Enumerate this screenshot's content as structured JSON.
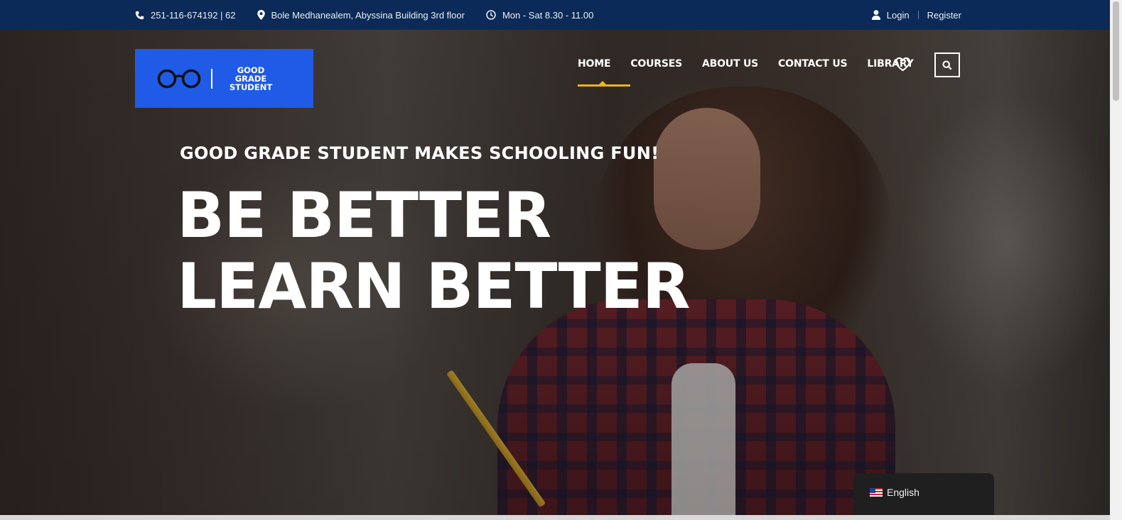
{
  "topbar": {
    "phone": "251-116-674192 | 62",
    "address": "Bole Medhanealem, Abyssina Building 3rd floor",
    "hours": "Mon - Sat 8.30 - 11.00",
    "login": "Login",
    "register": "Register"
  },
  "logo": {
    "line1": "GOOD GRADE",
    "line2": "STUDENT",
    "color": "#1f5be6"
  },
  "nav": {
    "items": [
      "HOME",
      "COURSES",
      "ABOUT US",
      "CONTACT US",
      "LIBRARY"
    ],
    "active": "HOME",
    "accent": "#f1b21a"
  },
  "hero": {
    "tagline": "GOOD GRADE STUDENT MAKES SCHOOLING FUN!",
    "headline_line1": "BE BETTER",
    "headline_line2": "LEARN BETTER"
  },
  "language": {
    "label": "English",
    "flag": "us-flag-icon"
  },
  "colors": {
    "topbar": "#0b2a57"
  }
}
